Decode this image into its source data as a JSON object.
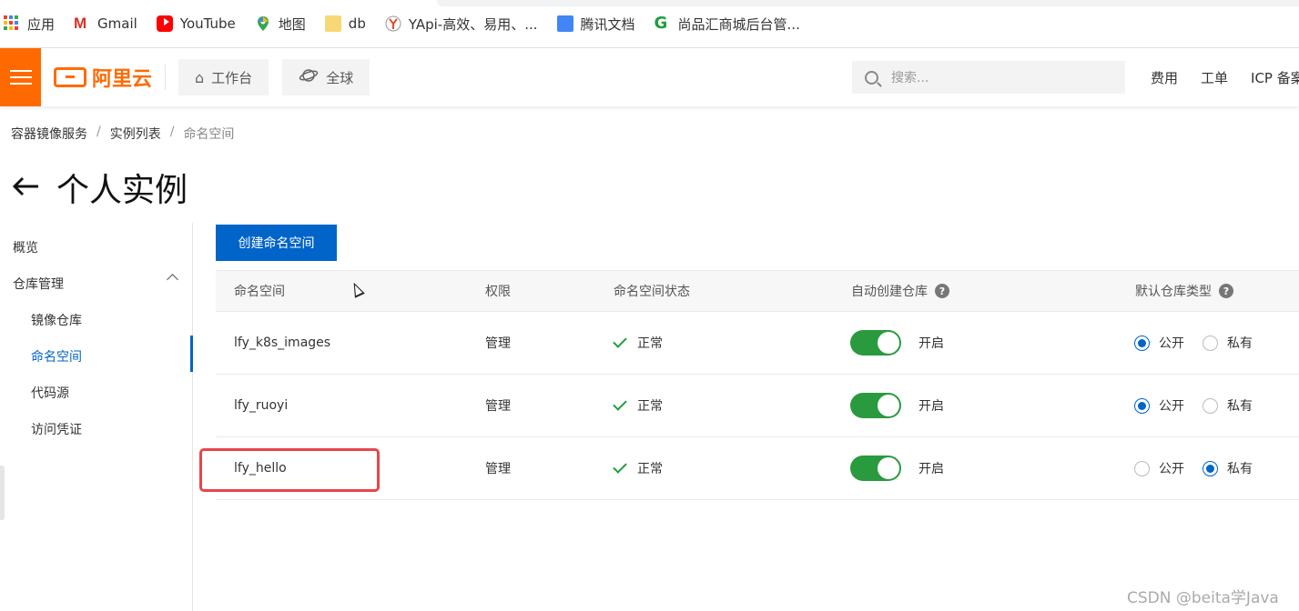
{
  "bookmarks": [
    "应用",
    "Gmail",
    "YouTube",
    "地图",
    "db",
    "YApi-高效、易用、...",
    "腾讯文档",
    "尚品汇商城后台管..."
  ],
  "header": {
    "logo_text": "阿里云",
    "workbench": "工作台",
    "region": "全球",
    "search_placeholder": "搜索...",
    "links": [
      "费用",
      "工单",
      "ICP 备案"
    ]
  },
  "breadcrumb": [
    "容器镜像服务",
    "实例列表",
    "命名空间"
  ],
  "page_title": "个人实例",
  "sidebar": {
    "overview": "概览",
    "repo_mgmt": "仓库管理",
    "items": [
      "镜像仓库",
      "命名空间",
      "代码源",
      "访问凭证"
    ]
  },
  "create_button": "创建命名空间",
  "table": {
    "headers": [
      "命名空间",
      "权限",
      "命名空间状态",
      "自动创建仓库",
      "默认仓库类型"
    ],
    "rows": [
      {
        "name": "lfy_k8s_images",
        "permission": "管理",
        "status": "正常",
        "auto_create": "开启",
        "public_label": "公开",
        "private_label": "私有",
        "default_type": "public"
      },
      {
        "name": "lfy_ruoyi",
        "permission": "管理",
        "status": "正常",
        "auto_create": "开启",
        "public_label": "公开",
        "private_label": "私有",
        "default_type": "public"
      },
      {
        "name": "lfy_hello",
        "permission": "管理",
        "status": "正常",
        "auto_create": "开启",
        "public_label": "公开",
        "private_label": "私有",
        "default_type": "private"
      }
    ]
  },
  "watermark": "CSDN @beita学Java",
  "colors": {
    "brand": "#ff6a00",
    "primary": "#0064c8",
    "switch_on": "#2a9a3e",
    "highlight": "#e8454a"
  }
}
